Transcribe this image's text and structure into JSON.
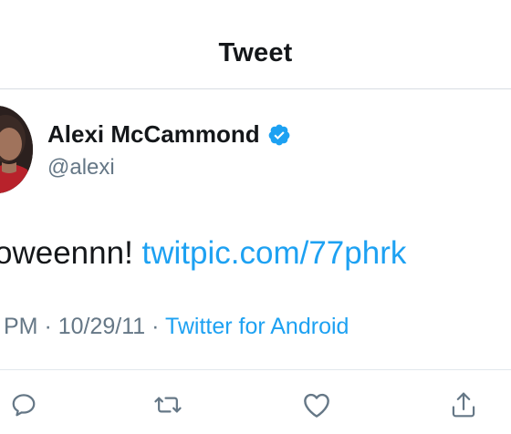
{
  "header": {
    "title": "Tweet"
  },
  "author": {
    "name": "Alexi McCammond",
    "handle": "@alexi",
    "verified": true,
    "verified_icon": "verified-badge-icon"
  },
  "tweet": {
    "text": "oweennn! ",
    "link_text": "twitpic.com/77phrk"
  },
  "meta": {
    "time_fragment": "PM",
    "separator": " · ",
    "date": "10/29/11",
    "client": "Twitter for Android"
  },
  "actions": [
    {
      "name": "reply",
      "icon": "reply-icon"
    },
    {
      "name": "retweet",
      "icon": "retweet-icon"
    },
    {
      "name": "like",
      "icon": "heart-icon"
    },
    {
      "name": "share",
      "icon": "share-icon"
    }
  ],
  "colors": {
    "link": "#1da1f2",
    "secondary_text": "#657786",
    "primary_text": "#14171a",
    "divider": "#e1e8ed"
  }
}
